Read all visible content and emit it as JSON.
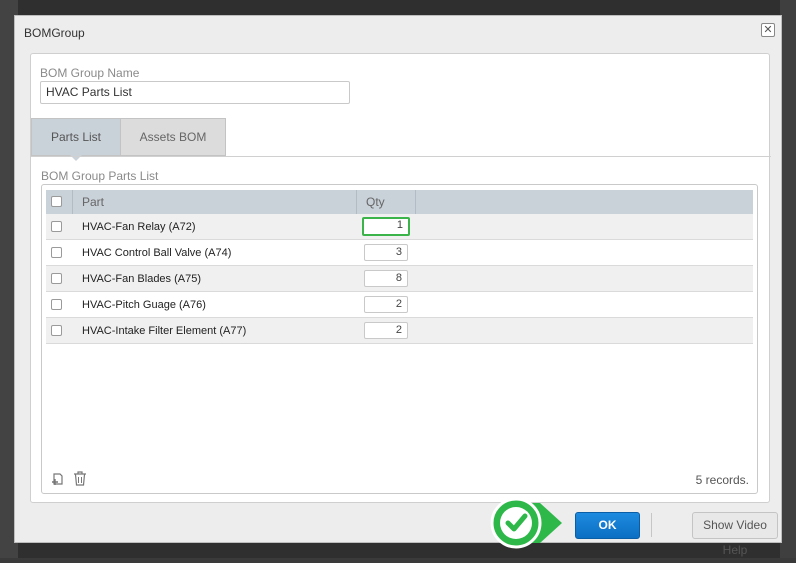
{
  "dialog": {
    "title": "BOMGroup",
    "close_label": "✕"
  },
  "form": {
    "name_label": "BOM Group Name",
    "name_value": "HVAC Parts List"
  },
  "tabs": [
    {
      "label": "Parts List",
      "active": true
    },
    {
      "label": "Assets BOM",
      "active": false
    }
  ],
  "parts": {
    "section_label": "BOM Group Parts List",
    "columns": {
      "part": "Part",
      "qty": "Qty"
    },
    "rows": [
      {
        "part": "HVAC-Fan Relay (A72)",
        "qty": "1"
      },
      {
        "part": "HVAC Control Ball Valve (A74)",
        "qty": "3"
      },
      {
        "part": "HVAC-Fan Blades (A75)",
        "qty": "8"
      },
      {
        "part": "HVAC-Pitch Guage (A76)",
        "qty": "2"
      },
      {
        "part": "HVAC-Intake Filter Element (A77)",
        "qty": "2"
      }
    ],
    "record_count": "5 records."
  },
  "buttons": {
    "ok": "OK",
    "help": "Show Video Help"
  },
  "colors": {
    "accent": "#1e8be0",
    "focus_green": "#3bb54a",
    "header_bg": "#c9d1d9"
  }
}
